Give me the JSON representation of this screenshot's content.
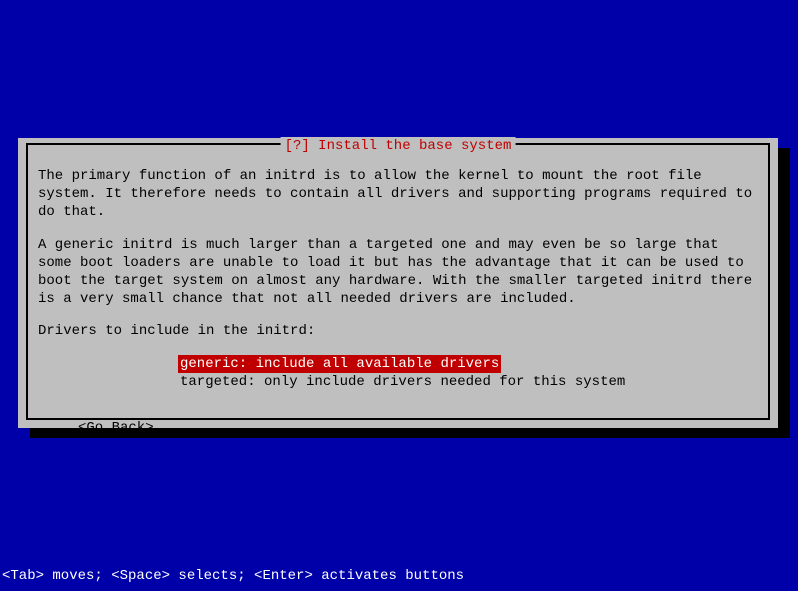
{
  "dialog": {
    "title": "[?] Install the base system",
    "para1": "The primary function of an initrd is to allow the kernel to mount the root file system. It therefore needs to contain all drivers and supporting programs required to do that.",
    "para2": "A generic initrd is much larger than a targeted one and may even be so large that some boot loaders are unable to load it but has the advantage that it can be used to boot the target system on almost any hardware. With the smaller targeted initrd there is a very small chance that not all needed drivers are included.",
    "prompt": "Drivers to include in the initrd:",
    "options": [
      "generic: include all available drivers",
      "targeted: only include drivers needed for this system"
    ],
    "go_back": "<Go Back>"
  },
  "footer": "<Tab> moves; <Space> selects; <Enter> activates buttons"
}
